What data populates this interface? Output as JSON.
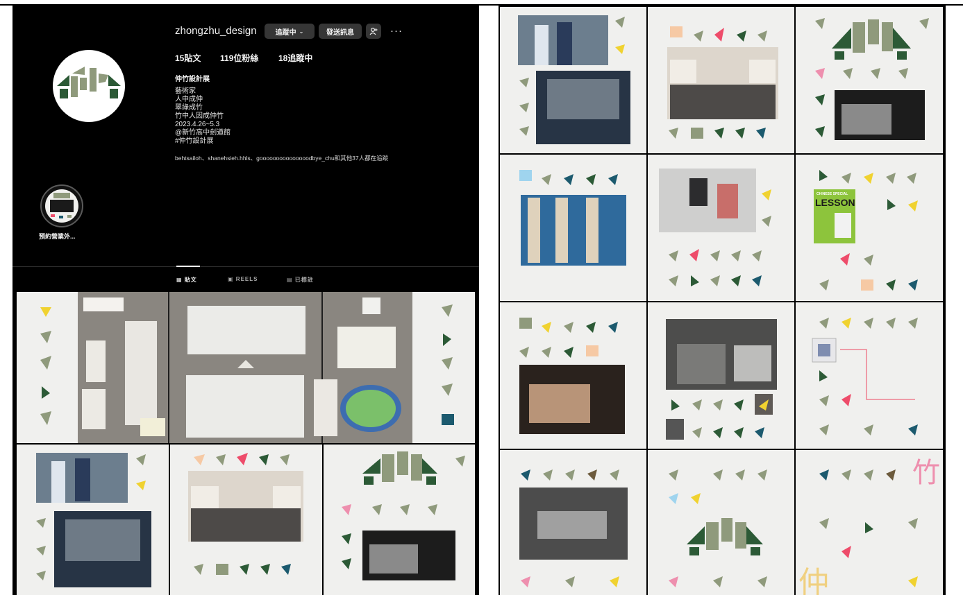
{
  "profile": {
    "username": "zhongzhu_design",
    "follow_label": "追蹤中",
    "message_label": "發送訊息",
    "more_label": "···",
    "posts_count": "15",
    "posts_label": "貼文",
    "followers_count": "119",
    "followers_label": "位粉絲",
    "following_count": "18",
    "following_label": "追蹤中",
    "display_name": "仲竹設計展",
    "bio_lines": [
      "藝術家",
      "人中成仲",
      "翠綠成竹",
      "竹中人因成仲竹",
      "2023.4.26~5.3",
      "@新竹高中劍道館",
      "#仲竹設計展"
    ],
    "followed_by": "behtsailoh、shanehsieh.hhls、gooooooooooooooodbye_chu和其他37人都在追蹤"
  },
  "highlight": {
    "label": "預約營業外..."
  },
  "tabs": [
    {
      "label": "貼文"
    },
    {
      "label": "REELS"
    },
    {
      "label": "已標註"
    }
  ],
  "post_texts": {
    "lesson_title": "LESSON",
    "lesson_top": "CHINESE   SPECIAL",
    "chars_bamboo": "竹",
    "chars_zhong": "仲"
  },
  "colors": {
    "olive": "#8f9a7c",
    "dark_green": "#2c5a36",
    "teal": "#1c5a6e",
    "pink": "#ee4c6a",
    "yellow": "#f0d230",
    "peach": "#f6c9a4",
    "sky": "#9fd4ee",
    "brown": "#6c5a3c"
  }
}
